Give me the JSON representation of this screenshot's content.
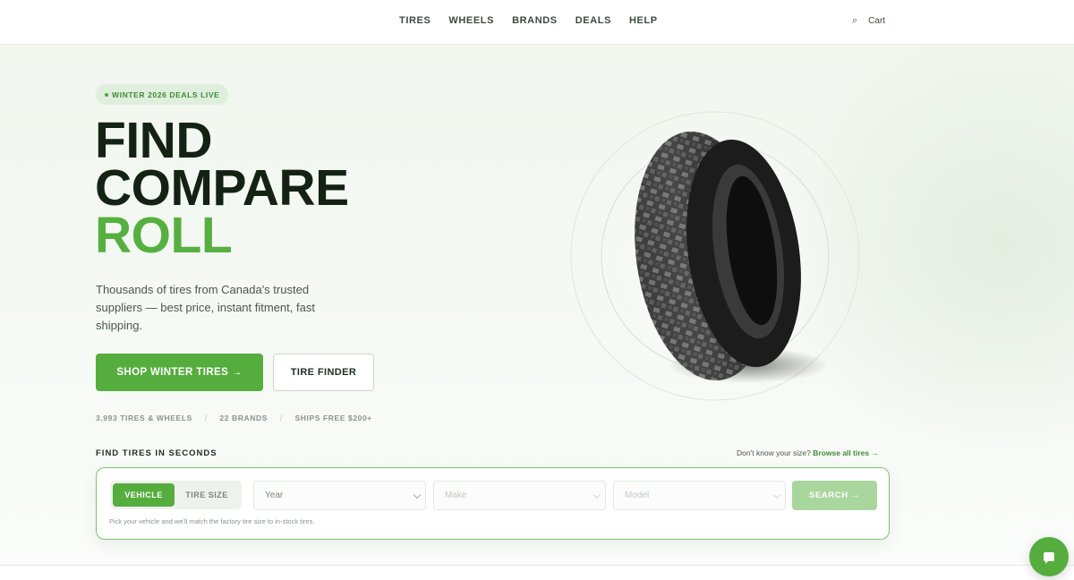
{
  "nav": {
    "links": [
      "TIRES",
      "WHEELS",
      "BRANDS",
      "DEALS",
      "HELP"
    ],
    "search_icon": "search-icon",
    "cart_label": "Cart"
  },
  "hero": {
    "badge": "WINTER 2026 DEALS LIVE",
    "headline": [
      "FIND",
      "COMPARE",
      "ROLL"
    ],
    "subtext": "Thousands of tires from Canada's trusted suppliers — best price, instant fitment, fast shipping.",
    "primary_cta": "SHOP WINTER TIRES →",
    "secondary_cta": "TIRE FINDER",
    "stats": [
      "3,993 TIRES & WHEELS",
      "22 BRANDS",
      "SHIPS FREE $200+"
    ],
    "stat_separator": "/"
  },
  "finder": {
    "title": "FIND TIRES IN SECONDS",
    "help_text": "Don't know your size?",
    "help_link": "Browse all tires →",
    "tabs": [
      "VEHICLE",
      "TIRE SIZE"
    ],
    "active_tab": "VEHICLE",
    "selects": {
      "year": "Year",
      "make": "Make",
      "model": "Model"
    },
    "search_label": "SEARCH →",
    "note": "Pick your vehicle and we'll match the factory tire size to in-stock tires."
  },
  "colors": {
    "accent": "#55ad3e",
    "dark": "#142214"
  },
  "chat": {
    "icon": "chat-icon"
  }
}
